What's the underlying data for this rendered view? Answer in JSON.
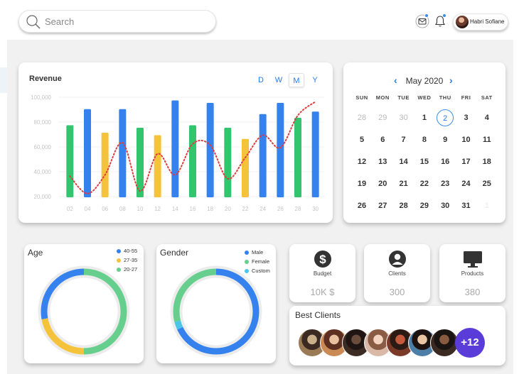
{
  "header": {
    "search_placeholder": "Search",
    "user_name": "Habri Sofiane",
    "accent_color": "#3d8bf0"
  },
  "revenue": {
    "title": "Revenue",
    "periods": [
      "D",
      "W",
      "M",
      "Y"
    ],
    "active_period": "M"
  },
  "chart_data": {
    "type": "bar",
    "title": "Revenue",
    "categories": [
      "02",
      "04",
      "06",
      "08",
      "10",
      "12",
      "14",
      "16",
      "18",
      "20",
      "22",
      "24",
      "26",
      "28",
      "30"
    ],
    "y_ticks": [
      "20,000",
      "40,000",
      "60,000",
      "80,000",
      "100,000"
    ],
    "ylim": [
      20000,
      100000
    ],
    "grid": true,
    "values": [
      78000,
      91000,
      72000,
      91000,
      76000,
      70000,
      98000,
      78000,
      96000,
      76000,
      67000,
      87000,
      96000,
      84000,
      89000
    ],
    "bar_colors": [
      "#33c46e",
      "#3582ef",
      "#f5c33b",
      "#3582ef",
      "#33c46e",
      "#f5c33b",
      "#3582ef",
      "#33c46e",
      "#3582ef",
      "#33c46e",
      "#f5c33b",
      "#3582ef",
      "#3582ef",
      "#33c46e",
      "#3582ef"
    ],
    "trend_line": {
      "color": "#e23b3b",
      "style": "dotted",
      "x": [
        "02",
        "04",
        "06",
        "08",
        "10",
        "12",
        "14",
        "16",
        "18",
        "20",
        "22",
        "24",
        "26",
        "28",
        "30"
      ],
      "y": [
        37000,
        23000,
        38000,
        64000,
        25000,
        55000,
        38000,
        63000,
        62000,
        35000,
        52000,
        70000,
        60000,
        86000,
        97000
      ]
    }
  },
  "calendar": {
    "month_label": "May 2020",
    "prev_icon": "chevron-left-icon",
    "next_icon": "chevron-right-icon",
    "weekdays": [
      "SUN",
      "MON",
      "TUE",
      "WED",
      "THU",
      "FRI",
      "SAT"
    ],
    "weeks": [
      [
        "28",
        "29",
        "30",
        "1",
        "2",
        "3",
        "4"
      ],
      [
        "5",
        "6",
        "7",
        "8",
        "9",
        "10",
        "11"
      ],
      [
        "12",
        "13",
        "14",
        "15",
        "16",
        "17",
        "18"
      ],
      [
        "19",
        "20",
        "21",
        "22",
        "23",
        "24",
        "25"
      ],
      [
        "26",
        "27",
        "28",
        "29",
        "30",
        "31",
        "1"
      ]
    ],
    "today": "2"
  },
  "age": {
    "title": "Age",
    "legend": [
      {
        "label": "40-55",
        "color": "#3582ef"
      },
      {
        "label": "27-35",
        "color": "#f5c33b"
      },
      {
        "label": "20-27",
        "color": "#66cf8e"
      }
    ],
    "segments": [
      0.28,
      0.22,
      0.5
    ]
  },
  "gender": {
    "title": "Gender",
    "legend": [
      {
        "label": "Male",
        "color": "#3582ef"
      },
      {
        "label": "Female",
        "color": "#66cf8e"
      },
      {
        "label": "Custom",
        "color": "#4bc6e8"
      }
    ],
    "segments": [
      0.68,
      0.29,
      0.03
    ]
  },
  "stats": [
    {
      "label": "Budget",
      "value": "10K $",
      "icon": "dollar-icon"
    },
    {
      "label": "Clients",
      "value": "300",
      "icon": "user-icon"
    },
    {
      "label": "Products",
      "value": "380",
      "icon": "monitor-icon"
    }
  ],
  "best_clients": {
    "title": "Best Clients",
    "more_label": "+12",
    "avatar_count": 7
  }
}
